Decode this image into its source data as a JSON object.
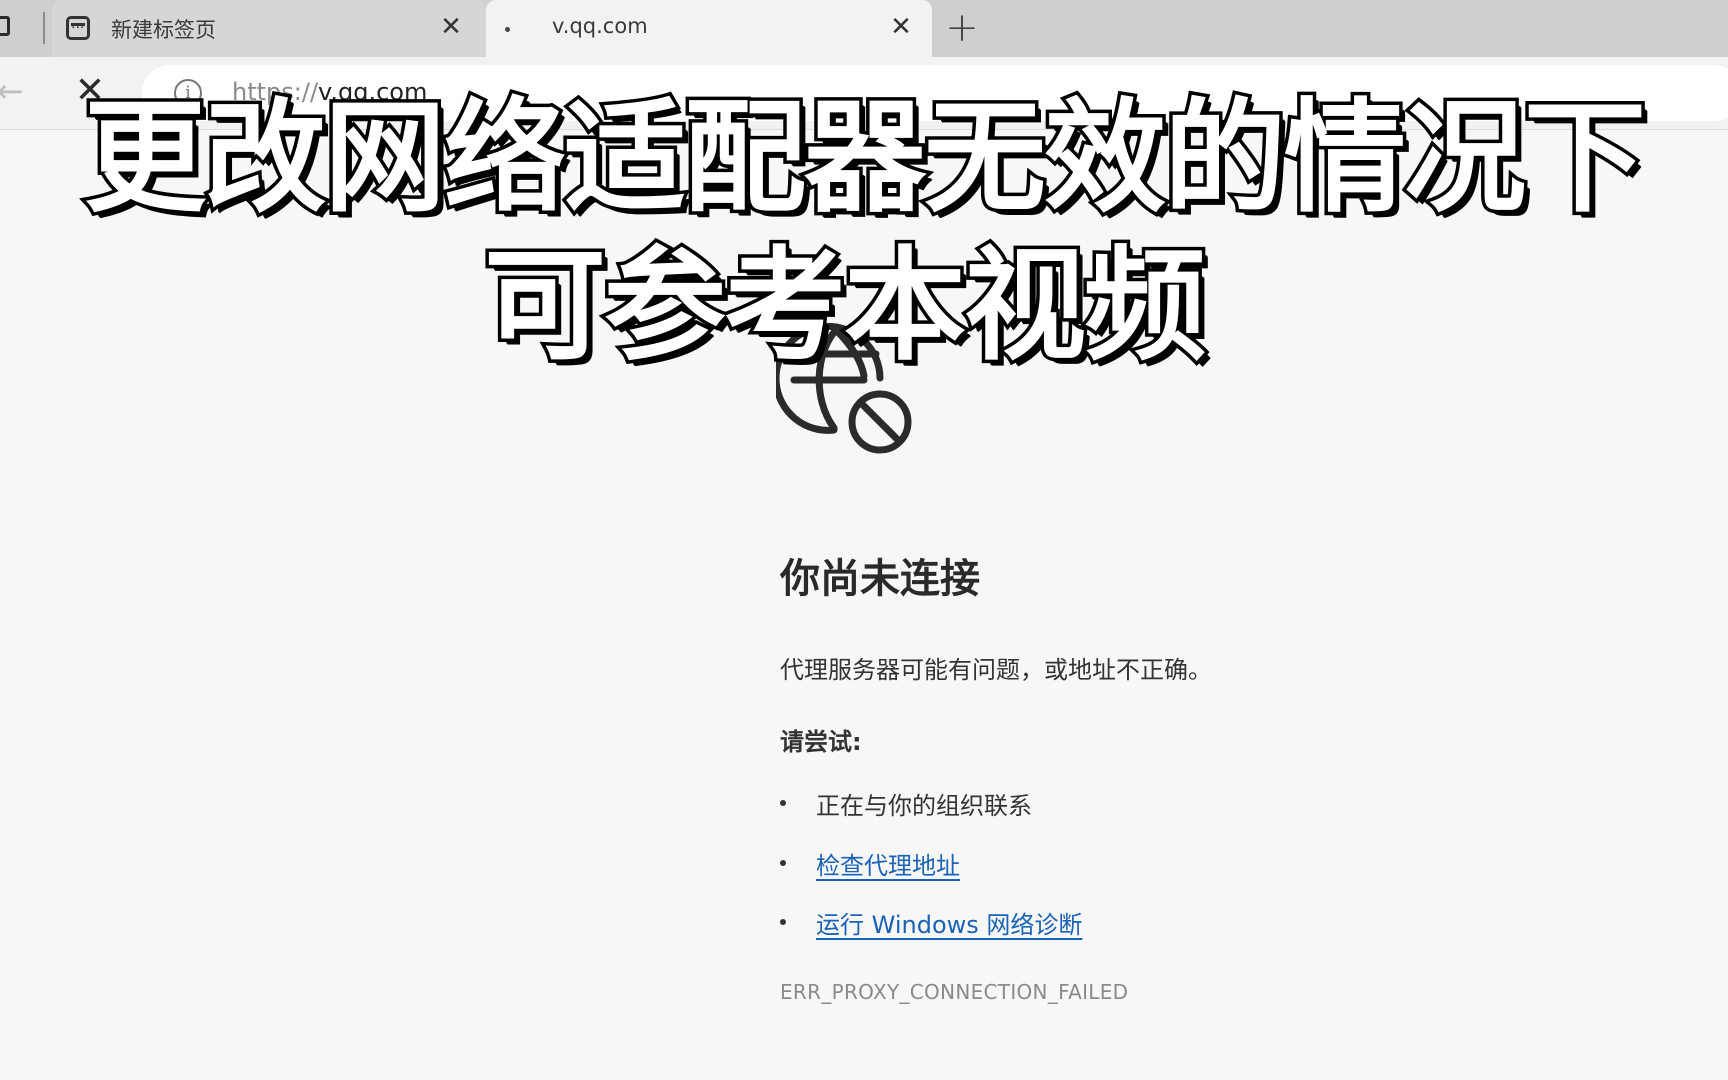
{
  "tabs": [
    {
      "title": "新建标签页",
      "favicon": "new-tab-page-icon",
      "active": false
    },
    {
      "title": "v.qq.com",
      "favicon": "loading-dot-icon",
      "active": true
    }
  ],
  "toolbar": {
    "url_scheme": "https://",
    "url_host": "v.qq.com",
    "back_icon": "arrow-left-icon",
    "stop_icon": "close-icon",
    "info_icon": "info-icon"
  },
  "caption": {
    "line1": "更改网络适配器无效的情况下",
    "line2": "可参考本视频"
  },
  "error_page": {
    "icon": "globe-blocked-icon",
    "title": "你尚未连接",
    "description": "代理服务器可能有问题，或地址不正确。",
    "try_label": "请尝试:",
    "suggestions": [
      {
        "text": "正在与你的组织联系",
        "link": false
      },
      {
        "text": "检查代理地址",
        "link": true
      },
      {
        "text": "运行 Windows 网络诊断",
        "link": true
      }
    ],
    "error_code": "ERR_PROXY_CONNECTION_FAILED"
  },
  "colors": {
    "link": "#1a63b5",
    "page_bg": "#f7f7f7",
    "tabstrip_bg": "#cfcfcf"
  }
}
